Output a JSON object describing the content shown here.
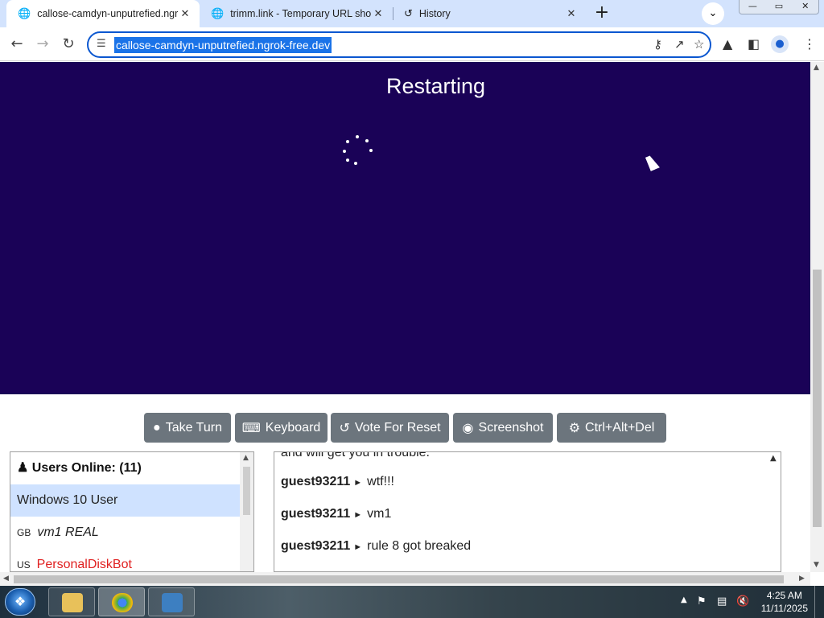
{
  "browser": {
    "tabs": [
      {
        "title": "callose-camdyn-unputrefied.ngr",
        "active": true,
        "icon": "globe-icon"
      },
      {
        "title": "trimm.link - Temporary URL sho",
        "active": false,
        "icon": "globe-icon"
      },
      {
        "title": "History",
        "active": false,
        "icon": "history-icon"
      }
    ],
    "address": "callose-camdyn-unputrefied.ngrok-free.dev",
    "accent_color": "#0b57d0",
    "tabstrip_color": "#d3e3fd"
  },
  "vm": {
    "status_text": "Restarting",
    "background_color": "#1a0257"
  },
  "controls": {
    "take_turn": "Take Turn",
    "keyboard": "Keyboard",
    "vote_reset": "Vote For Reset",
    "screenshot": "Screenshot",
    "ctrl_alt_del": "Ctrl+Alt+Del",
    "button_color": "#6c757d"
  },
  "users": {
    "header": "Users Online: (11)",
    "list": [
      {
        "name": "Windows 10 User",
        "flag": "",
        "selected": true
      },
      {
        "name": "vm1 REAL",
        "flag": "GB",
        "italic": true
      },
      {
        "name": "PersonalDiskBot",
        "flag": "US",
        "color": "#e02020"
      }
    ]
  },
  "chat": {
    "partial_text": "and will get you in trouble.",
    "messages": [
      {
        "user": "guest93211",
        "text": "wtf!!!"
      },
      {
        "user": "guest93211",
        "text": "vm1"
      },
      {
        "user": "guest93211",
        "text": "rule 8 got breaked"
      }
    ]
  },
  "taskbar": {
    "time": "4:25 AM",
    "date": "11/11/2025"
  }
}
